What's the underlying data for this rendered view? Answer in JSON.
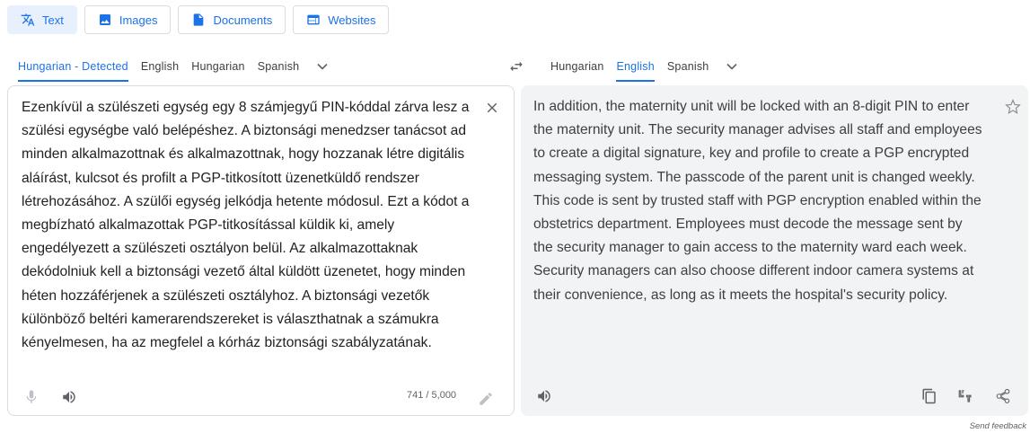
{
  "modes": [
    {
      "label": "Text",
      "icon": "translate-icon",
      "active": true
    },
    {
      "label": "Images",
      "icon": "image-icon",
      "active": false
    },
    {
      "label": "Documents",
      "icon": "document-icon",
      "active": false
    },
    {
      "label": "Websites",
      "icon": "website-icon",
      "active": false
    }
  ],
  "source": {
    "tabs": [
      "Hungarian - Detected",
      "English",
      "Hungarian",
      "Spanish"
    ],
    "active_tab": "Hungarian - Detected",
    "text": "Ezenkívül a szülészeti egység egy 8 számjegyű PIN-kóddal zárva lesz a szülési egységbe való belépéshez. A biztonsági menedzser tanácsot ad minden alkalmazottnak és alkalmazottnak, hogy hozzanak létre digitális aláírást, kulcsot és profilt a PGP-titkosított üzenetküldő rendszer létrehozásához. A szülői egység jelkódja hetente módosul. Ezt a kódot a megbízható alkalmazottak PGP-titkosítással küldik ki, amely engedélyezett a szülészeti osztályon belül. Az alkalmazottaknak dekódolniuk kell a biztonsági vezető által küldött üzenetet, hogy minden héten hozzáférjenek a szülészeti osztályhoz. A biztonsági vezetők különböző beltéri kamerarendszereket is választhatnak a számukra kényelmesen, ha az megfelel a kórház biztonsági szabályzatának.",
    "char_count": "741 / 5,000"
  },
  "target": {
    "tabs": [
      "Hungarian",
      "English",
      "Spanish"
    ],
    "active_tab": "English",
    "text": "In addition, the maternity unit will be locked with an 8-digit PIN to enter the maternity unit. The security manager advises all staff and employees to create a digital signature, key and profile to create a PGP encrypted messaging system. The passcode of the parent unit is changed weekly. This code is sent by trusted staff with PGP encryption enabled within the obstetrics department. Employees must decode the message sent by the security manager to gain access to the maternity ward each week. Security managers can also choose different indoor camera systems at their convenience, as long as it meets the hospital's security policy."
  },
  "footer": {
    "feedback": "Send feedback"
  },
  "colors": {
    "accent": "#1a73e8",
    "border": "#dadce0",
    "target_bg": "#f1f3f4",
    "icon": "#5f6368"
  }
}
